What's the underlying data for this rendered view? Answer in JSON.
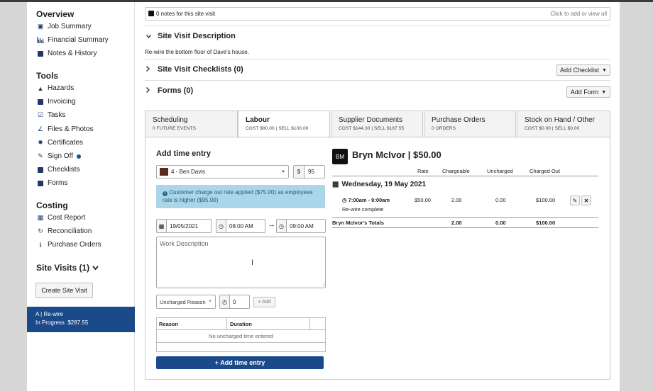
{
  "sidebar": {
    "overview": {
      "heading": "Overview",
      "items": [
        {
          "icon": "briefcase-icon",
          "label": "Job Summary"
        },
        {
          "icon": "chart-icon",
          "label": "Financial Summary"
        },
        {
          "icon": "note-icon",
          "label": "Notes & History"
        }
      ]
    },
    "tools": {
      "heading": "Tools",
      "items": [
        {
          "icon": "warning-icon",
          "label": "Hazards"
        },
        {
          "icon": "dollar-icon",
          "label": "Invoicing"
        },
        {
          "icon": "check-square-icon",
          "label": "Tasks"
        },
        {
          "icon": "paperclip-icon",
          "label": "Files & Photos"
        },
        {
          "icon": "certificate-icon",
          "label": "Certificates"
        },
        {
          "icon": "pen-icon",
          "label": "Sign Off"
        },
        {
          "icon": "clipboard-icon",
          "label": "Checklists"
        },
        {
          "icon": "file-icon",
          "label": "Forms"
        }
      ]
    },
    "costing": {
      "heading": "Costing",
      "items": [
        {
          "icon": "table-icon",
          "label": "Cost Report"
        },
        {
          "icon": "refresh-icon",
          "label": "Reconciliation"
        },
        {
          "icon": "info-icon",
          "label": "Purchase Orders"
        }
      ]
    },
    "site_visits_heading": "Site Visits (1)",
    "create_button": "Create Site Visit",
    "visit_card": {
      "line1": "A | Re-wire",
      "status": "In Progress",
      "amount": "$287.55"
    }
  },
  "notes_bar": {
    "text": "0 notes for this site visit",
    "action": "Click to add or view all"
  },
  "site_visit_description": {
    "title": "Site Visit Description",
    "text": "Re-wire the bottom floor of Dave's house."
  },
  "checklists": {
    "title": "Site Visit Checklists (0)",
    "button": "Add Checklist"
  },
  "forms": {
    "title": "Forms (0)",
    "button": "Add Form"
  },
  "tabs": [
    {
      "label": "Scheduling",
      "sub": "0 FUTURE EVENTS"
    },
    {
      "label": "Labour",
      "sub": "COST $80.00 | SELL $100.00"
    },
    {
      "label": "Supplier Documents",
      "sub": "COST $144.30 | SELL $187.55"
    },
    {
      "label": "Purchase Orders",
      "sub": "0 ORDERS"
    },
    {
      "label": "Stock on Hand / Other",
      "sub": "COST $0.00 | SELL $0.00"
    }
  ],
  "add_time": {
    "heading": "Add time entry",
    "employee": "4 - Ben Davis",
    "currency": "$",
    "rate": "95",
    "info": "Customer charge out rate applied ($75.00) as employees rate is higher ($95.00)",
    "date": "19/05/2021",
    "start": "08:00 AM",
    "end": "09:00 AM",
    "desc_placeholder": "Work Description",
    "uncharged_placeholder": "Uncharged Reason",
    "uncharged_duration": "0",
    "add_small": "+ Add",
    "table_headers": [
      "Reason",
      "Duration"
    ],
    "table_empty": "No uncharged time entered",
    "submit": "+ Add time entry"
  },
  "summary": {
    "initials": "BM",
    "name": "Bryn McIvor | $50.00",
    "headers": [
      "Rate",
      "Chargeable",
      "Uncharged",
      "Charged Out"
    ],
    "date": "Wednesday, 19 May 2021",
    "entry": {
      "time": "7:00am - 9:00am",
      "desc": "Re-wire complete",
      "rate": "$50.00",
      "chargeable": "2.00",
      "uncharged": "0.00",
      "charged_out": "$100.00"
    },
    "totals": {
      "label": "Bryn McIvor's Totals",
      "chargeable": "2.00",
      "uncharged": "0.00",
      "charged_out": "$100.00"
    }
  }
}
